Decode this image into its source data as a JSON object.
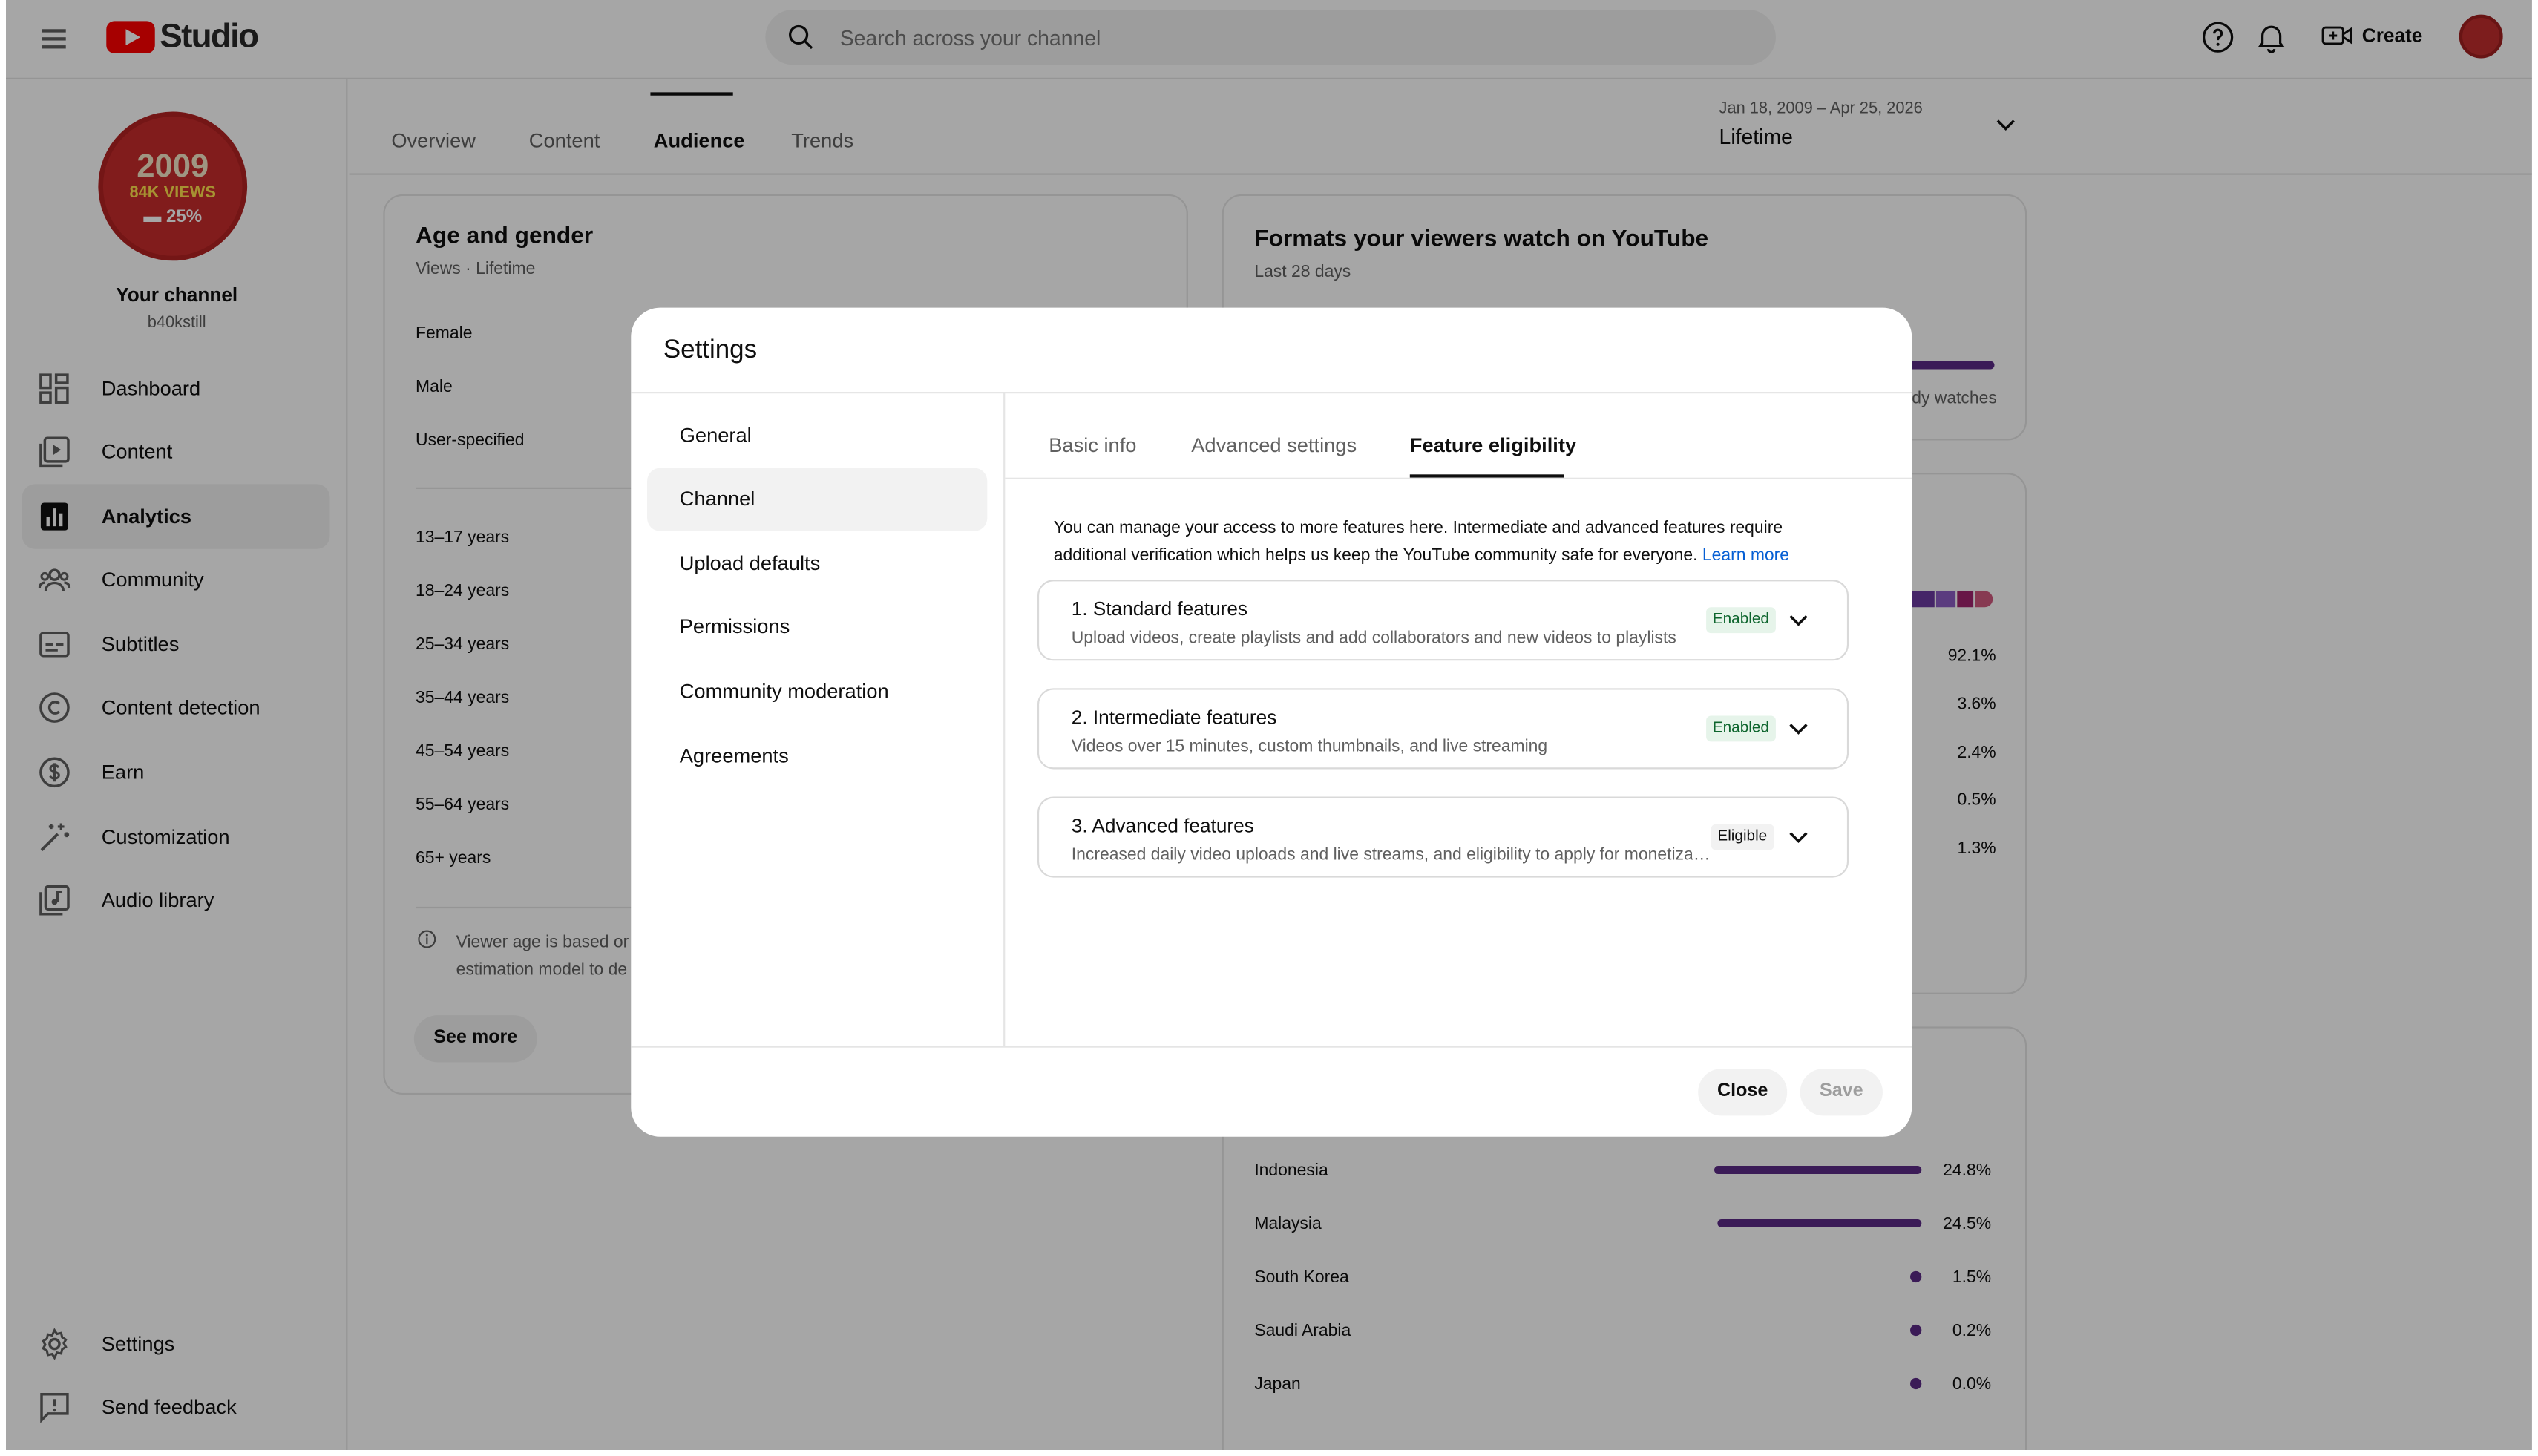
{
  "app": {
    "name": "Studio"
  },
  "search": {
    "placeholder": "Search across your channel"
  },
  "header": {
    "create_label": "Create"
  },
  "channel": {
    "title": "Your channel",
    "handle": "b40kstill",
    "avatar_lines": [
      "2009",
      "84K VIEWS",
      "▬ 25%"
    ]
  },
  "sidebar": {
    "items": [
      {
        "label": "Dashboard",
        "icon": "dashboard-icon"
      },
      {
        "label": "Content",
        "icon": "content-icon"
      },
      {
        "label": "Analytics",
        "icon": "analytics-icon",
        "active": true
      },
      {
        "label": "Community",
        "icon": "community-icon"
      },
      {
        "label": "Subtitles",
        "icon": "subtitles-icon"
      },
      {
        "label": "Content detection",
        "icon": "copyright-icon"
      },
      {
        "label": "Earn",
        "icon": "dollar-icon"
      },
      {
        "label": "Customization",
        "icon": "magic-wand-icon"
      },
      {
        "label": "Audio library",
        "icon": "audio-library-icon"
      }
    ],
    "bottom": [
      {
        "label": "Settings",
        "icon": "gear-icon"
      },
      {
        "label": "Send feedback",
        "icon": "feedback-icon"
      }
    ]
  },
  "tabs": [
    "Overview",
    "Content",
    "Audience",
    "Trends"
  ],
  "active_tab": "Audience",
  "date": {
    "range": "Jan 18, 2009 – Apr 25, 2026",
    "label": "Lifetime"
  },
  "age_gender": {
    "title": "Age and gender",
    "subtitle": "Views · Lifetime",
    "genders": [
      "Female",
      "Male",
      "User-specified"
    ],
    "ages": [
      "13–17 years",
      "18–24 years",
      "25–34 years",
      "35–44 years",
      "45–54 years",
      "55–64 years",
      "65+ years"
    ],
    "note_line1": "Viewer age is based or",
    "note_line2": "estimation model to de",
    "see_more": "See more"
  },
  "formats": {
    "title": "Formats your viewers watch on YouTube",
    "subtitle": "Last 28 days",
    "partial_label": "dy watches"
  },
  "devices_percent": [
    "92.1%",
    "3.6%",
    "2.4%",
    "0.5%",
    "1.3%"
  ],
  "geography": {
    "rows": [
      {
        "country": "Indonesia",
        "value": "24.8%",
        "share": 24.8
      },
      {
        "country": "Malaysia",
        "value": "24.5%",
        "share": 24.5
      },
      {
        "country": "South Korea",
        "value": "1.5%",
        "share": 1.5
      },
      {
        "country": "Saudi Arabia",
        "value": "0.2%",
        "share": 0.2
      },
      {
        "country": "Japan",
        "value": "0.0%",
        "share": 0.0
      }
    ]
  },
  "dialog": {
    "title": "Settings",
    "nav": [
      "General",
      "Channel",
      "Upload defaults",
      "Permissions",
      "Community moderation",
      "Agreements"
    ],
    "active_nav": "Channel",
    "tabs": [
      "Basic info",
      "Advanced settings",
      "Feature eligibility"
    ],
    "active_tab": "Feature eligibility",
    "description": "You can manage your access to more features here. Intermediate and advanced features require additional verification which helps us keep the YouTube community safe for everyone.",
    "learn_more": "Learn more",
    "features": [
      {
        "title": "1. Standard features",
        "subtitle": "Upload videos, create playlists and add collaborators and new videos to playlists",
        "status": "Enabled"
      },
      {
        "title": "2. Intermediate features",
        "subtitle": "Videos over 15 minutes, custom thumbnails, and live streaming",
        "status": "Enabled"
      },
      {
        "title": "3. Advanced features",
        "subtitle": "Increased daily video uploads and live streams, and eligibility to apply for monetization",
        "status": "Eligible"
      }
    ],
    "close_label": "Close",
    "save_label": "Save"
  },
  "colors": {
    "accent_red": "#ff0000",
    "bar_purple": "#5b2a86",
    "link_blue": "#065fd4",
    "enabled_green": "#0d652d"
  }
}
